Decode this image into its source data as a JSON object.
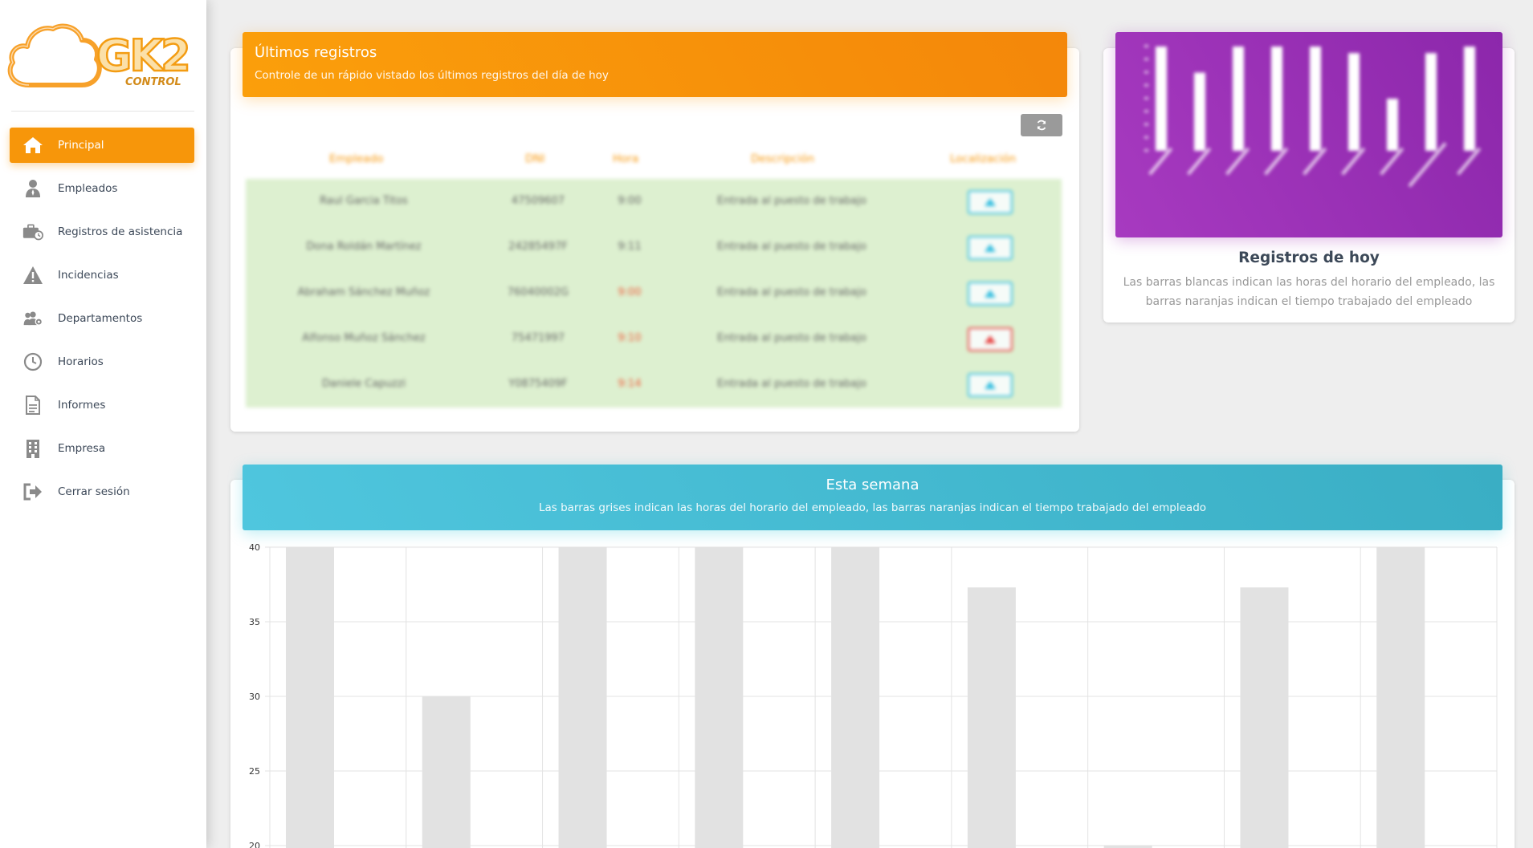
{
  "sidebar": {
    "logo": {
      "text": "GK2",
      "subtext": "CONTROL"
    },
    "items": [
      {
        "label": "Principal",
        "icon": "home-icon",
        "active": true
      },
      {
        "label": "Empleados",
        "icon": "user-icon",
        "active": false
      },
      {
        "label": "Registros de asistencia",
        "icon": "briefcase-clock-icon",
        "active": false
      },
      {
        "label": "Incidencias",
        "icon": "warning-icon",
        "active": false
      },
      {
        "label": "Departamentos",
        "icon": "users-gear-icon",
        "active": false
      },
      {
        "label": "Horarios",
        "icon": "clock-icon",
        "active": false
      },
      {
        "label": "Informes",
        "icon": "document-icon",
        "active": false
      },
      {
        "label": "Empresa",
        "icon": "building-icon",
        "active": false
      },
      {
        "label": "Cerrar sesión",
        "icon": "sign-out-icon",
        "active": false
      }
    ]
  },
  "last_records": {
    "title": "Últimos registros",
    "subtitle": "Controle de un rápido vistado los últimos registros del día de hoy",
    "refresh_icon": "refresh-icon",
    "columns": [
      "Empleado",
      "DNI",
      "Hora",
      "Descripción",
      "Localización"
    ],
    "rows": [
      {
        "employee": "Raul Garcia Titos",
        "dni": "47509607",
        "time": "9:00",
        "late": false,
        "description": "Entrada al puesto de trabajo",
        "loc_status": "ok"
      },
      {
        "employee": "Dona Roldán Martínez",
        "dni": "24285497F",
        "time": "9:11",
        "late": false,
        "description": "Entrada al puesto de trabajo",
        "loc_status": "ok"
      },
      {
        "employee": "Abraham Sánchez Muñoz",
        "dni": "76040002G",
        "time": "9:00",
        "late": true,
        "description": "Entrada al puesto de trabajo",
        "loc_status": "ok"
      },
      {
        "employee": "Alfonso Muñoz Sánchez",
        "dni": "75471997",
        "time": "9:10",
        "late": true,
        "description": "Entrada al puesto de trabajo",
        "loc_status": "alert"
      },
      {
        "employee": "Daniele Capuzzi",
        "dni": "Y0875409F",
        "time": "9:14",
        "late": true,
        "description": "Entrada al puesto de trabajo",
        "loc_status": "ok"
      }
    ],
    "colors": {
      "header_text": "#f7960a",
      "row_bg": "#ddf0d0",
      "late": "#f05b3a"
    }
  },
  "today": {
    "title": "Registros de hoy",
    "description": "Las barras blancas indican las horas del horario del empleado, las barras naranjas indican el tiempo trabajado del empleado",
    "chart_data": {
      "type": "bar",
      "values": [
        8,
        6,
        8,
        8,
        8,
        7.5,
        4,
        7.5,
        8
      ],
      "ylim": [
        0,
        8
      ],
      "bar_color": "#ffffff"
    }
  },
  "week": {
    "title": "Esta semana",
    "subtitle": "Las barras grises indican las horas del horario del empleado, las barras naranjas indican el tiempo trabajado del empleado",
    "chart_data": {
      "type": "bar",
      "categories": [
        "",
        "",
        "",
        "",
        "",
        "",
        "",
        "",
        ""
      ],
      "values": [
        40,
        30,
        40,
        40,
        40,
        37.3,
        20,
        37.3,
        40
      ],
      "ylim": [
        20,
        40
      ],
      "yticks": [
        40,
        35,
        30,
        25,
        20
      ],
      "grid": true,
      "bar_color": "#e2e2e2"
    }
  },
  "theme": {
    "accent_orange": "#f7960a",
    "header_cyan": "#45bcd6",
    "header_purple": "#9b30b8"
  }
}
